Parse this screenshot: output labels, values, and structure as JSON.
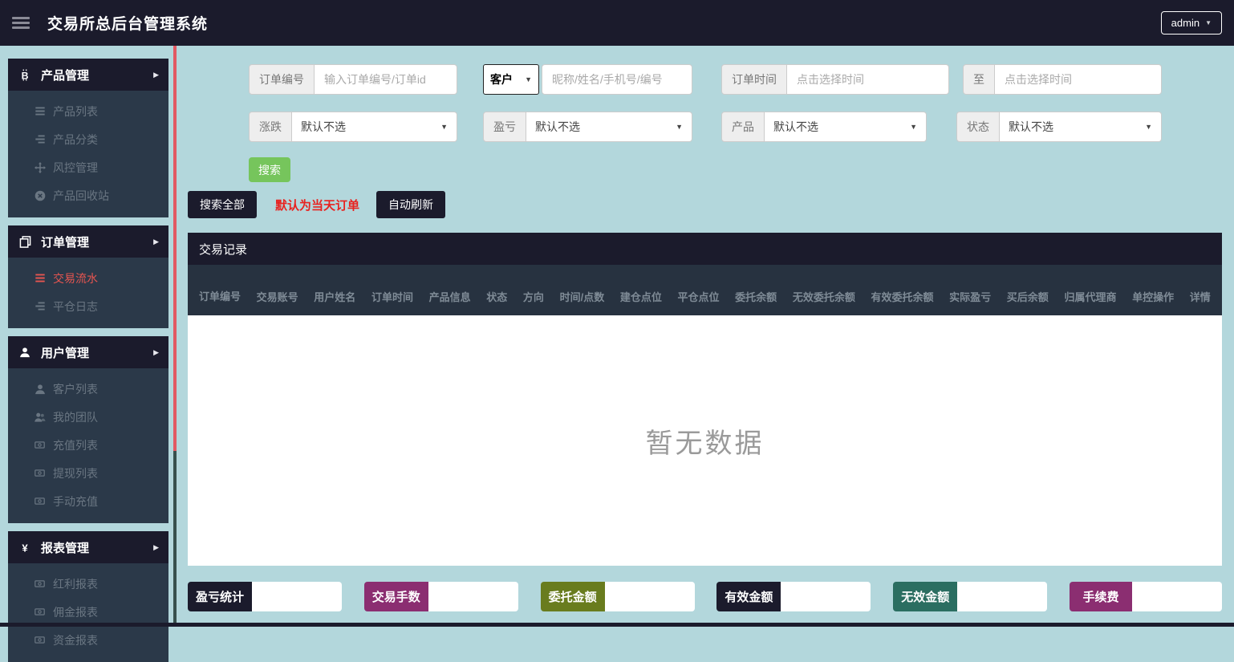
{
  "header": {
    "title": "交易所总后台管理系统",
    "user_menu": "admin"
  },
  "sidebar": {
    "groups": [
      {
        "label": "产品管理",
        "icon": "bitcoin",
        "items": [
          {
            "name": "product-list",
            "label": "产品列表",
            "icon": "list"
          },
          {
            "name": "product-category",
            "label": "产品分类",
            "icon": "list-indent"
          },
          {
            "name": "risk-control",
            "label": "风控管理",
            "icon": "arrows"
          },
          {
            "name": "product-recycle",
            "label": "产品回收站",
            "icon": "circle-x"
          }
        ]
      },
      {
        "label": "订单管理",
        "icon": "copy",
        "items": [
          {
            "name": "trade-flow",
            "label": "交易流水",
            "icon": "list",
            "active": true
          },
          {
            "name": "close-log",
            "label": "平仓日志",
            "icon": "list-indent"
          }
        ]
      },
      {
        "label": "用户管理",
        "icon": "user",
        "items": [
          {
            "name": "customer-list",
            "label": "客户列表",
            "icon": "user"
          },
          {
            "name": "my-team",
            "label": "我的团队",
            "icon": "users"
          },
          {
            "name": "recharge-list",
            "label": "充值列表",
            "icon": "banknote"
          },
          {
            "name": "withdraw-list",
            "label": "提现列表",
            "icon": "banknote"
          },
          {
            "name": "manual-recharge",
            "label": "手动充值",
            "icon": "banknote"
          }
        ]
      },
      {
        "label": "报表管理",
        "icon": "yen",
        "items": [
          {
            "name": "bonus-report",
            "label": "红利报表",
            "icon": "banknote"
          },
          {
            "name": "commission-report",
            "label": "佣金报表",
            "icon": "banknote"
          },
          {
            "name": "fund-report",
            "label": "资金报表",
            "icon": "banknote"
          }
        ]
      }
    ]
  },
  "filters": {
    "row1": [
      {
        "name": "order-no",
        "type": "label-input",
        "label": "订单编号",
        "placeholder": "输入订单编号/订单id",
        "value": ""
      },
      {
        "name": "customer",
        "type": "select-input",
        "select": "客户",
        "placeholder": "昵称/姓名/手机号/编号",
        "value": ""
      },
      {
        "name": "time-start",
        "type": "label-input",
        "label": "订单时间",
        "placeholder": "点击选择时间",
        "value": ""
      },
      {
        "name": "time-end",
        "type": "label-input",
        "label": "至",
        "placeholder": "点击选择时间",
        "value": ""
      }
    ],
    "row2": [
      {
        "name": "updown",
        "label": "涨跌",
        "selected": "默认不选"
      },
      {
        "name": "profit",
        "label": "盈亏",
        "selected": "默认不选"
      },
      {
        "name": "product",
        "label": "产品",
        "selected": "默认不选"
      },
      {
        "name": "status",
        "label": "状态",
        "selected": "默认不选"
      }
    ],
    "search_button": "搜索"
  },
  "toolbar": {
    "search_all_button": "搜索全部",
    "note": "默认为当天订单",
    "auto_refresh_button": "自动刷新"
  },
  "table": {
    "title": "交易记录",
    "columns": [
      "订单编号",
      "交易账号",
      "用户姓名",
      "订单时间",
      "产品信息",
      "状态",
      "方向",
      "时间/点数",
      "建仓点位",
      "平仓点位",
      "委托余额",
      "无效委托余额",
      "有效委托余额",
      "实际盈亏",
      "买后余额",
      "归属代理商",
      "单控操作",
      "详情"
    ],
    "empty_text": "暂无数据"
  },
  "stats": [
    {
      "name": "profit-stat",
      "label": "盈亏统计",
      "value": "",
      "color": "#1b1b2c"
    },
    {
      "name": "trade-lots",
      "label": "交易手数",
      "value": "",
      "color": "#8b2e71"
    },
    {
      "name": "entrust-amount",
      "label": "委托金额",
      "value": "",
      "color": "#697c1e"
    },
    {
      "name": "valid-amount",
      "label": "有效金额",
      "value": "",
      "color": "#1b1b2c"
    },
    {
      "name": "invalid-amount",
      "label": "无效金额",
      "value": "",
      "color": "#2b6e61"
    },
    {
      "name": "fee",
      "label": "手续费",
      "value": "",
      "color": "#8b2e71"
    }
  ],
  "colors": {
    "page_bg": "#b3d7dc",
    "panel_dark": "#1b1b2c",
    "sidebar_bg": "#2b3949",
    "active_red": "#e65550",
    "search_green": "#76c55c",
    "note_red": "#e8221f",
    "scrollbar_red": "#e25862",
    "column_header_bg": "#273240"
  }
}
